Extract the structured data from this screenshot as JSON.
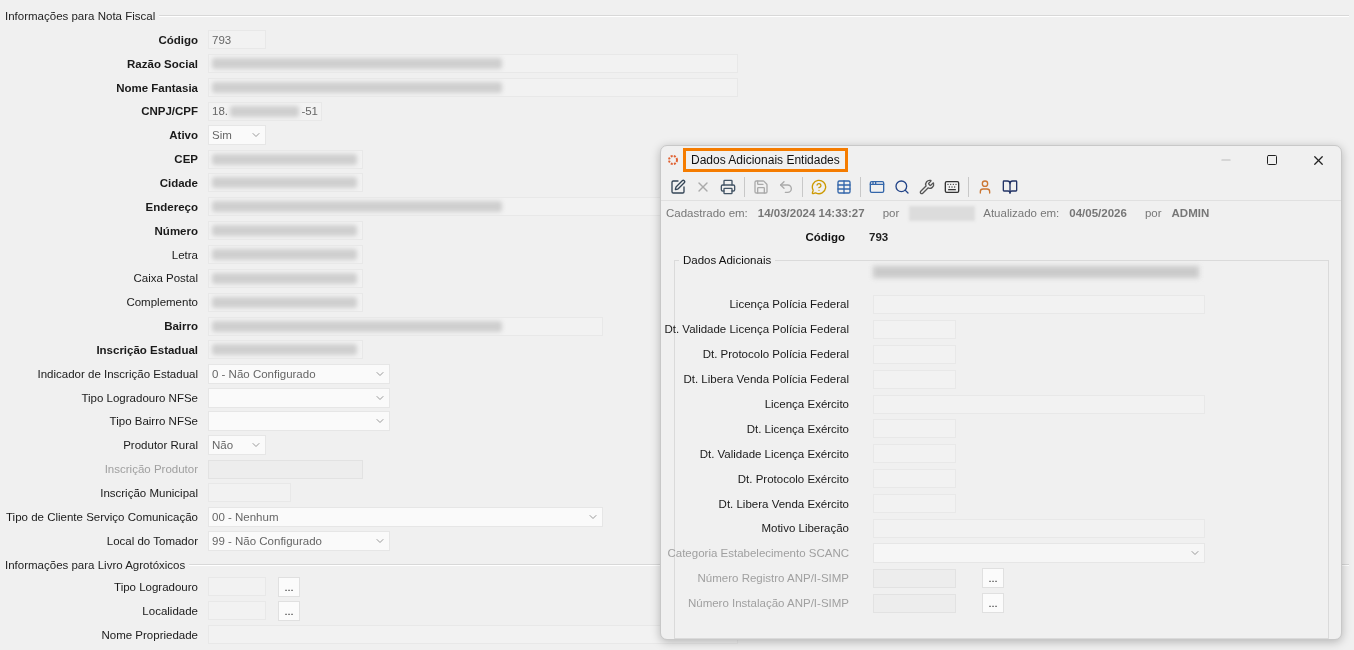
{
  "nota_fiscal": {
    "title": "Informações para Nota Fiscal",
    "fields": [
      {
        "label": "Código",
        "bold": true,
        "kind": "text",
        "value": "793"
      },
      {
        "label": "Razão Social",
        "bold": true,
        "kind": "text",
        "redacted": true
      },
      {
        "label": "Nome Fantasia",
        "bold": true,
        "kind": "text",
        "redacted": true
      },
      {
        "label": "CNPJ/CPF",
        "bold": true,
        "kind": "text",
        "value": "18.",
        "suffix": "-51",
        "redacted": true
      },
      {
        "label": "Ativo",
        "bold": true,
        "kind": "select",
        "value": "Sim"
      },
      {
        "label": "CEP",
        "bold": true,
        "kind": "text",
        "redacted": true
      },
      {
        "label": "Cidade",
        "bold": true,
        "kind": "text",
        "redacted": true
      },
      {
        "label": "Endereço",
        "bold": true,
        "kind": "text",
        "redacted": true
      },
      {
        "label": "Número",
        "bold": true,
        "kind": "text",
        "redacted": true
      },
      {
        "label": "Letra",
        "bold": false,
        "kind": "text",
        "redacted": true
      },
      {
        "label": "Caixa Postal",
        "bold": false,
        "kind": "text",
        "redacted": true
      },
      {
        "label": "Complemento",
        "bold": false,
        "kind": "text",
        "redacted": true
      },
      {
        "label": "Bairro",
        "bold": true,
        "kind": "text",
        "redacted": true
      },
      {
        "label": "Inscrição Estadual",
        "bold": true,
        "kind": "text",
        "redacted": true
      },
      {
        "label": "Indicador de Inscrição Estadual",
        "bold": false,
        "kind": "select",
        "value": "0 - Não Configurado"
      },
      {
        "label": "Tipo Logradouro NFSe",
        "bold": false,
        "kind": "select"
      },
      {
        "label": "Tipo Bairro NFSe",
        "bold": false,
        "kind": "select"
      },
      {
        "label": "Produtor Rural",
        "bold": false,
        "kind": "select",
        "value": "Não"
      },
      {
        "label": "Inscrição Produtor",
        "bold": false,
        "disabled": true,
        "kind": "text"
      },
      {
        "label": "Inscrição Municipal",
        "bold": false,
        "kind": "text"
      },
      {
        "label": "Tipo de Cliente Serviço Comunicação",
        "bold": false,
        "kind": "select",
        "value": "00 - Nenhum"
      },
      {
        "label": "Local do Tomador",
        "bold": false,
        "kind": "select",
        "value": "99 - Não Configurado"
      }
    ]
  },
  "agrotoxicos": {
    "title": "Informações para Livro Agrotóxicos",
    "fields": [
      {
        "label": "Tipo Logradouro",
        "bold": false,
        "kind": "lookup",
        "button": "..."
      },
      {
        "label": "Localidade",
        "bold": false,
        "kind": "lookup",
        "button": "..."
      },
      {
        "label": "Nome Propriedade",
        "bold": false,
        "kind": "text"
      }
    ]
  },
  "dialog": {
    "title": "Dados Adicionais Entidades",
    "highlighted": true,
    "toolbar": [
      {
        "kind": "edit",
        "disabled": false
      },
      {
        "kind": "delete",
        "disabled": true
      },
      {
        "kind": "print",
        "disabled": false
      },
      {
        "kind": "separator"
      },
      {
        "kind": "save",
        "disabled": true
      },
      {
        "kind": "undo",
        "disabled": true
      },
      {
        "kind": "separator"
      },
      {
        "kind": "help",
        "disabled": false
      },
      {
        "kind": "table",
        "disabled": false
      },
      {
        "kind": "separator"
      },
      {
        "kind": "windows",
        "disabled": false
      },
      {
        "kind": "search",
        "disabled": false
      },
      {
        "kind": "tools",
        "disabled": false
      },
      {
        "kind": "keyboard",
        "disabled": false
      },
      {
        "kind": "separator"
      },
      {
        "kind": "user",
        "disabled": false
      },
      {
        "kind": "book",
        "disabled": false
      }
    ],
    "meta": [
      {
        "kind": "label",
        "text": "Cadastrado em:"
      },
      {
        "kind": "value",
        "text": "14/03/2024 14:33:27"
      },
      {
        "kind": "label",
        "text": "por"
      },
      {
        "kind": "redacted"
      },
      {
        "kind": "label",
        "text": "Atualizado em:"
      },
      {
        "kind": "value",
        "text": "04/05/2026"
      },
      {
        "kind": "label",
        "text": "por"
      },
      {
        "kind": "value",
        "text": "ADMIN"
      }
    ],
    "code_label": "Código",
    "code_value": "793",
    "group": {
      "title": "Dados Adicionais",
      "redacted_line": true,
      "fields": [
        {
          "label": "Licença Polícia Federal",
          "kind": "text",
          "disabled": false
        },
        {
          "label": "Dt. Validade Licença Polícia Federal",
          "kind": "text",
          "disabled": false
        },
        {
          "label": "Dt. Protocolo Polícia Federal",
          "kind": "text",
          "disabled": false
        },
        {
          "label": "Dt. Libera Venda Polícia Federal",
          "kind": "text",
          "disabled": false
        },
        {
          "label": "Licença Exército",
          "kind": "text",
          "disabled": false
        },
        {
          "label": "Dt. Licença Exército",
          "kind": "text",
          "disabled": false
        },
        {
          "label": "Dt. Validade Licença Exército",
          "kind": "text",
          "disabled": false
        },
        {
          "label": "Dt. Protocolo Exército",
          "kind": "text",
          "disabled": false
        },
        {
          "label": "Dt. Libera Venda Exército",
          "kind": "text",
          "disabled": false
        },
        {
          "label": "Motivo Liberação",
          "kind": "text",
          "disabled": false
        },
        {
          "label": "Categoria Estabelecimento SCANC",
          "kind": "select",
          "disabled": true
        },
        {
          "label": "Número Registro ANP/I-SIMP",
          "kind": "lookup",
          "disabled": true,
          "button": "..."
        },
        {
          "label": "Número Instalação ANP/I-SIMP",
          "kind": "lookup",
          "disabled": true,
          "button": "..."
        }
      ]
    }
  }
}
